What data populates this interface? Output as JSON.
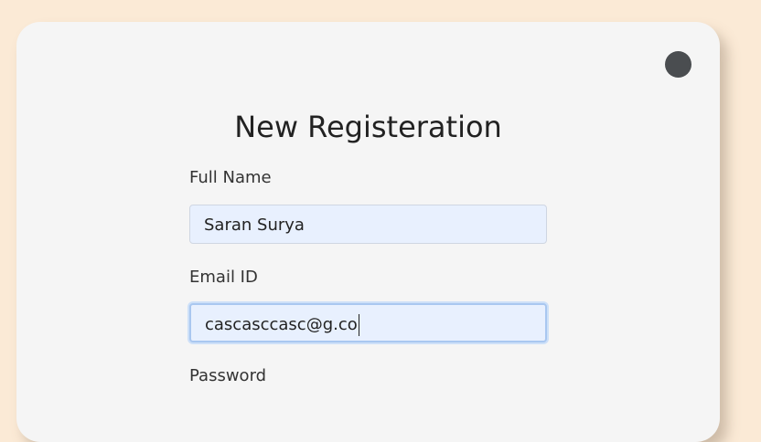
{
  "form": {
    "title": "New Registeration",
    "fields": [
      {
        "label": "Full Name",
        "value": "Saran Surya"
      },
      {
        "label": "Email ID",
        "value": "cascasccasc@g.co"
      },
      {
        "label": "Password"
      }
    ]
  },
  "colors": {
    "background": "#fbead6",
    "card": "#f5f5f5",
    "input_fill": "#e8f0fe",
    "close_dot": "#4a4d50"
  }
}
